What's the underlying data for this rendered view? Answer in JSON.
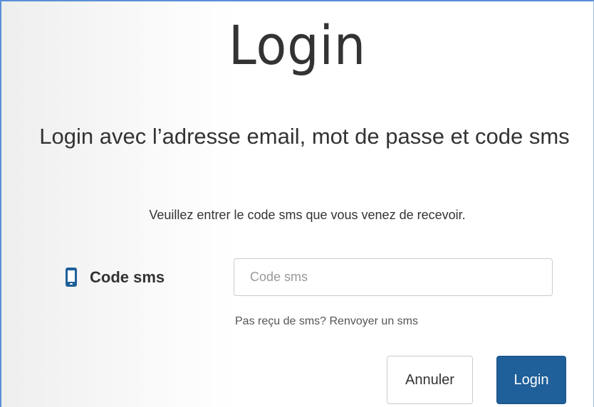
{
  "header": {
    "title": "Login"
  },
  "main": {
    "subtitle": "Login avec l’adresse email, mot de passe et code sms",
    "instruction": "Veuillez entrer le code sms que vous venez de recevoir.",
    "sms_field": {
      "label": "Code sms",
      "icon": "mobile-phone-icon",
      "value": "",
      "placeholder": "Code sms"
    },
    "resend_link": "Pas reçu de sms? Renvoyer un sms",
    "buttons": {
      "cancel_label": "Annuler",
      "login_label": "Login"
    }
  },
  "colors": {
    "primary_button": "#1f5f9a",
    "icon": "#1f5f9a",
    "text": "#333333",
    "frame_border": "#5b8fd6"
  }
}
